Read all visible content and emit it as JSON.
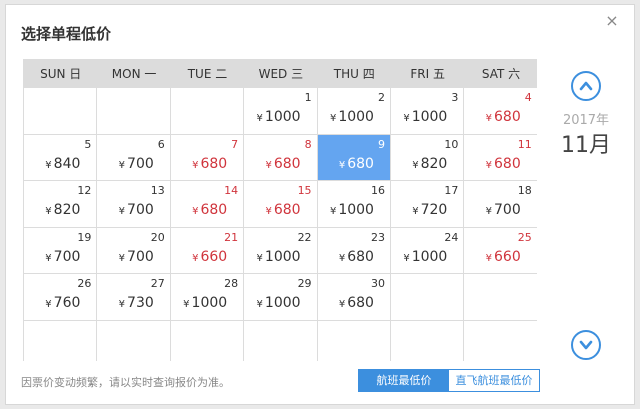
{
  "dialog": {
    "title": "选择单程低价",
    "close_icon": "close-icon"
  },
  "weekdays": [
    "SUN 日",
    "MON 一",
    "TUE 二",
    "WED 三",
    "THU 四",
    "FRI 五",
    "SAT 六"
  ],
  "currency": "¥",
  "calendar": {
    "year": "2017年",
    "month": "11月",
    "days": [
      null,
      null,
      null,
      {
        "day": "1",
        "price": "1000"
      },
      {
        "day": "2",
        "price": "1000"
      },
      {
        "day": "3",
        "price": "1000"
      },
      {
        "day": "4",
        "price": "680",
        "red": true
      },
      {
        "day": "5",
        "price": "840"
      },
      {
        "day": "6",
        "price": "700"
      },
      {
        "day": "7",
        "price": "680",
        "red": true
      },
      {
        "day": "8",
        "price": "680",
        "red": true
      },
      {
        "day": "9",
        "price": "680",
        "selected": true
      },
      {
        "day": "10",
        "price": "820"
      },
      {
        "day": "11",
        "price": "680",
        "red": true
      },
      {
        "day": "12",
        "price": "820"
      },
      {
        "day": "13",
        "price": "700"
      },
      {
        "day": "14",
        "price": "680",
        "red": true
      },
      {
        "day": "15",
        "price": "680",
        "red": true
      },
      {
        "day": "16",
        "price": "1000"
      },
      {
        "day": "17",
        "price": "720"
      },
      {
        "day": "18",
        "price": "700"
      },
      {
        "day": "19",
        "price": "700"
      },
      {
        "day": "20",
        "price": "700"
      },
      {
        "day": "21",
        "price": "660",
        "red": true
      },
      {
        "day": "22",
        "price": "1000"
      },
      {
        "day": "23",
        "price": "680"
      },
      {
        "day": "24",
        "price": "1000"
      },
      {
        "day": "25",
        "price": "660",
        "red": true
      },
      {
        "day": "26",
        "price": "760"
      },
      {
        "day": "27",
        "price": "730"
      },
      {
        "day": "28",
        "price": "1000"
      },
      {
        "day": "29",
        "price": "1000"
      },
      {
        "day": "30",
        "price": "680"
      },
      null,
      null,
      null,
      null,
      null,
      null,
      null,
      null,
      null
    ]
  },
  "nav": {
    "up_icon": "chevron-up-icon",
    "down_icon": "chevron-down-icon"
  },
  "footer": {
    "notice": "因票价变动频繁，请以实时查询报价为准。",
    "toggle_active": "航班最低价",
    "toggle_inactive": "直飞航班最低价"
  },
  "colors": {
    "accent": "#3c8fde",
    "selected": "#64a5f0",
    "low_price_red": "#d0343c",
    "header_bg": "#dcdcdc"
  }
}
